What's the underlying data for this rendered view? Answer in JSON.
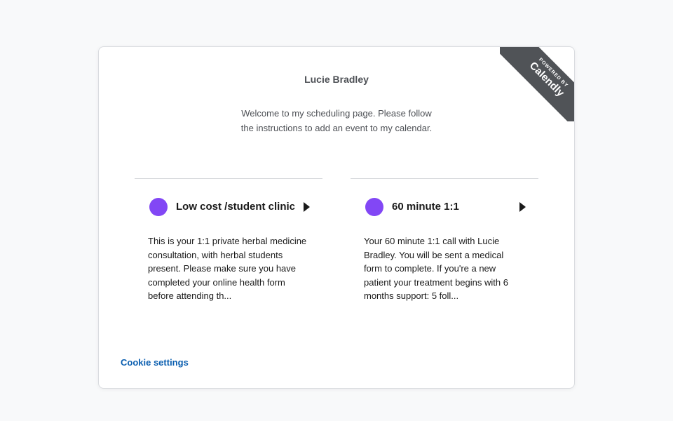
{
  "badge": {
    "powered_by": "POWERED BY",
    "brand": "Calendly"
  },
  "profile": {
    "name": "Lucie Bradley",
    "welcome": "Welcome to my scheduling page. Please follow the instructions to add an event to my calendar."
  },
  "events": [
    {
      "title": "Low cost /student clinic",
      "color": "#8247f5",
      "description": "This is your 1:1 private herbal medicine consultation, with herbal students present. Please make sure you have completed your online health form before attending th..."
    },
    {
      "title": "60 minute 1:1",
      "color": "#8247f5",
      "description": "Your 60 minute 1:1 call with Lucie Bradley. You will be sent a medical form to complete. If you're a new patient your treatment begins with 6 months support: 5 foll..."
    }
  ],
  "footer": {
    "cookie_settings": "Cookie settings"
  }
}
